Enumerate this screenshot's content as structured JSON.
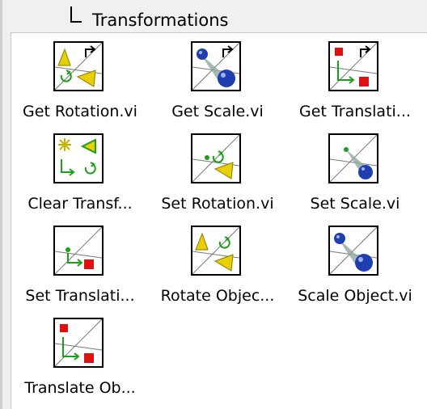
{
  "section": {
    "title": "Transformations"
  },
  "palette": {
    "items": [
      {
        "label": "Get Rotation.vi",
        "icon": "get-rotation-icon"
      },
      {
        "label": "Get Scale.vi",
        "icon": "get-scale-icon"
      },
      {
        "label": "Get Translati...",
        "icon": "get-translation-icon"
      },
      {
        "label": "Clear Transf...",
        "icon": "clear-transformation-icon"
      },
      {
        "label": "Set Rotation.vi",
        "icon": "set-rotation-icon"
      },
      {
        "label": "Set Scale.vi",
        "icon": "set-scale-icon"
      },
      {
        "label": "Set Translati...",
        "icon": "set-translation-icon"
      },
      {
        "label": "Rotate Objec...",
        "icon": "rotate-object-icon"
      },
      {
        "label": "Scale Object.vi",
        "icon": "scale-object-icon"
      },
      {
        "label": "Translate Ob...",
        "icon": "translate-object-icon"
      }
    ]
  },
  "colors": {
    "cone_yellow": "#e8d000",
    "sphere_blue": "#1f3fb0",
    "cube_red": "#e01010",
    "arrow_green": "#1aa01a"
  }
}
